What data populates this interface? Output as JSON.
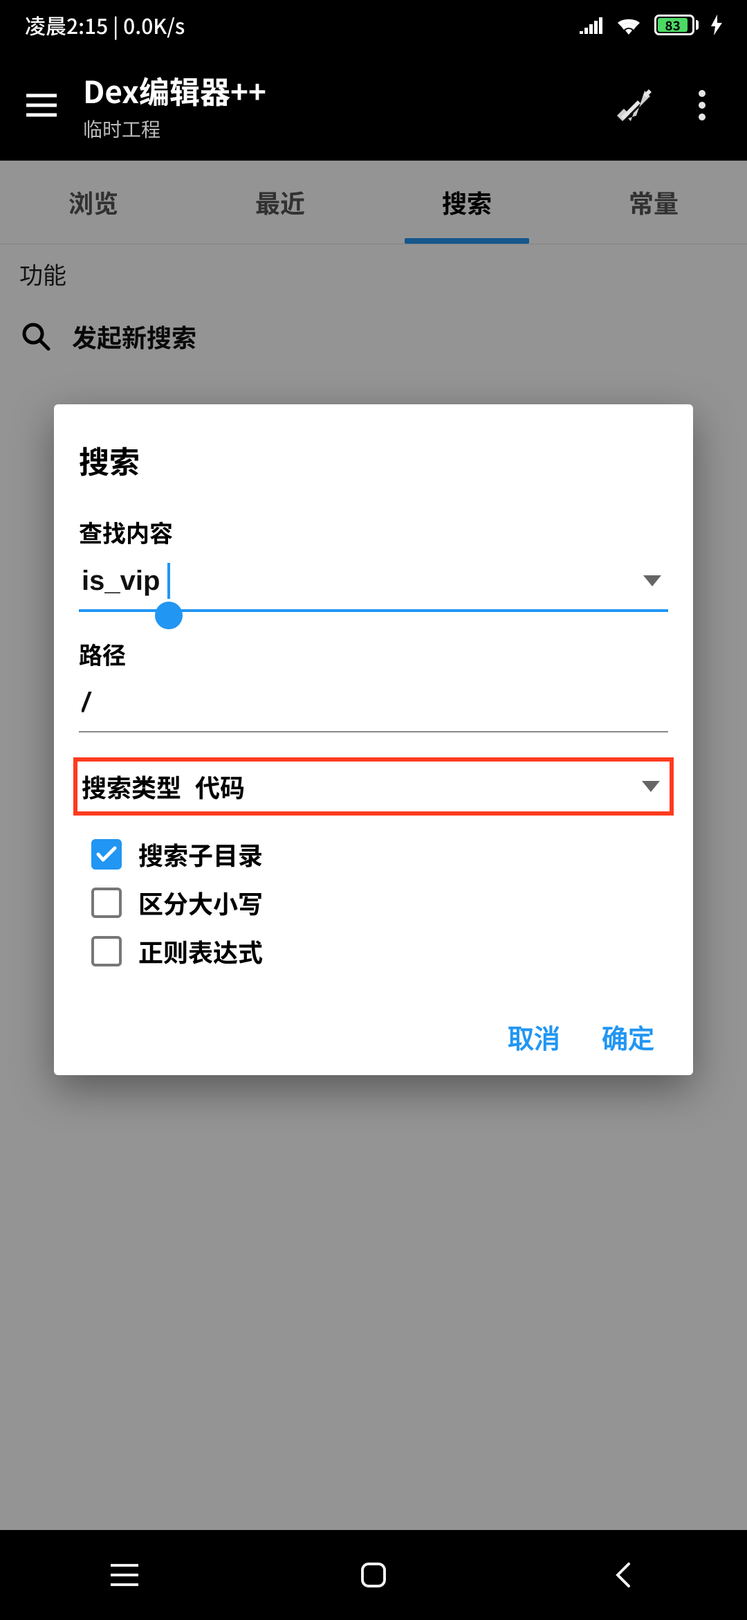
{
  "statusbar": {
    "time": "凌晨2:15 | 0.0K/s",
    "battery_pct": "83"
  },
  "toolbar": {
    "title": "Dex编辑器++",
    "subtitle": "临时工程"
  },
  "tabs": [
    "浏览",
    "最近",
    "搜索",
    "常量"
  ],
  "section": {
    "header": "功能",
    "new_search": "发起新搜索"
  },
  "dialog": {
    "title": "搜索",
    "content_label": "查找内容",
    "content_value": "is_vip",
    "path_label": "路径",
    "path_value": "/",
    "type_label": "搜索类型",
    "type_value": "代码",
    "check_subdir": "搜索子目录",
    "check_case": "区分大小写",
    "check_regex": "正则表达式",
    "cancel": "取消",
    "ok": "确定"
  }
}
